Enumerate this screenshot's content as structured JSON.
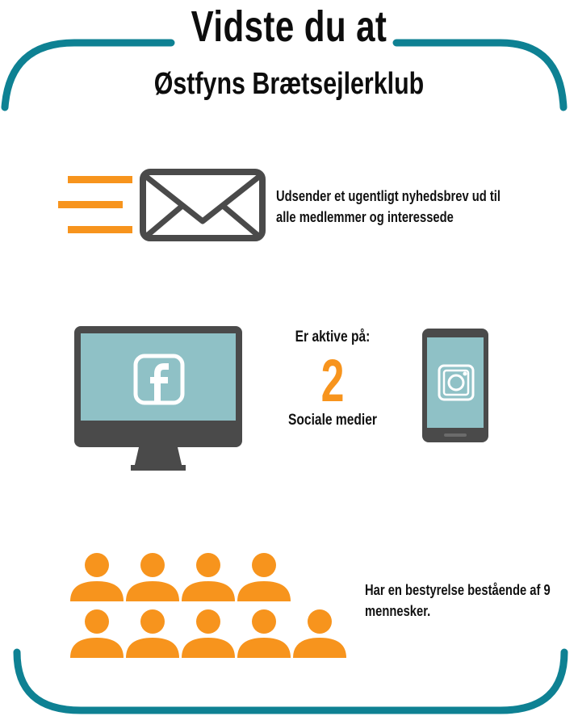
{
  "header": {
    "title": "Vidste du at",
    "subtitle": "Østfyns Brætsejlerklub"
  },
  "newsletter": {
    "icon": "envelope-icon",
    "text_line1": "Udsender et ugentligt nyhedsbrev ud til",
    "text_line2": "alle medlemmer og interessede"
  },
  "social": {
    "active_label": "Er aktive på:",
    "count": "2",
    "media_label": "Sociale medier",
    "icons": [
      "facebook-icon",
      "instagram-icon"
    ]
  },
  "board": {
    "text_line1": "Har en bestyrelse bestående af 9",
    "text_line2": "mennesker.",
    "members": 9
  },
  "colors": {
    "frame": "#0e8193",
    "accent": "#f7941d",
    "device": "#4a4a4a",
    "screen": "#8fc1c6"
  }
}
